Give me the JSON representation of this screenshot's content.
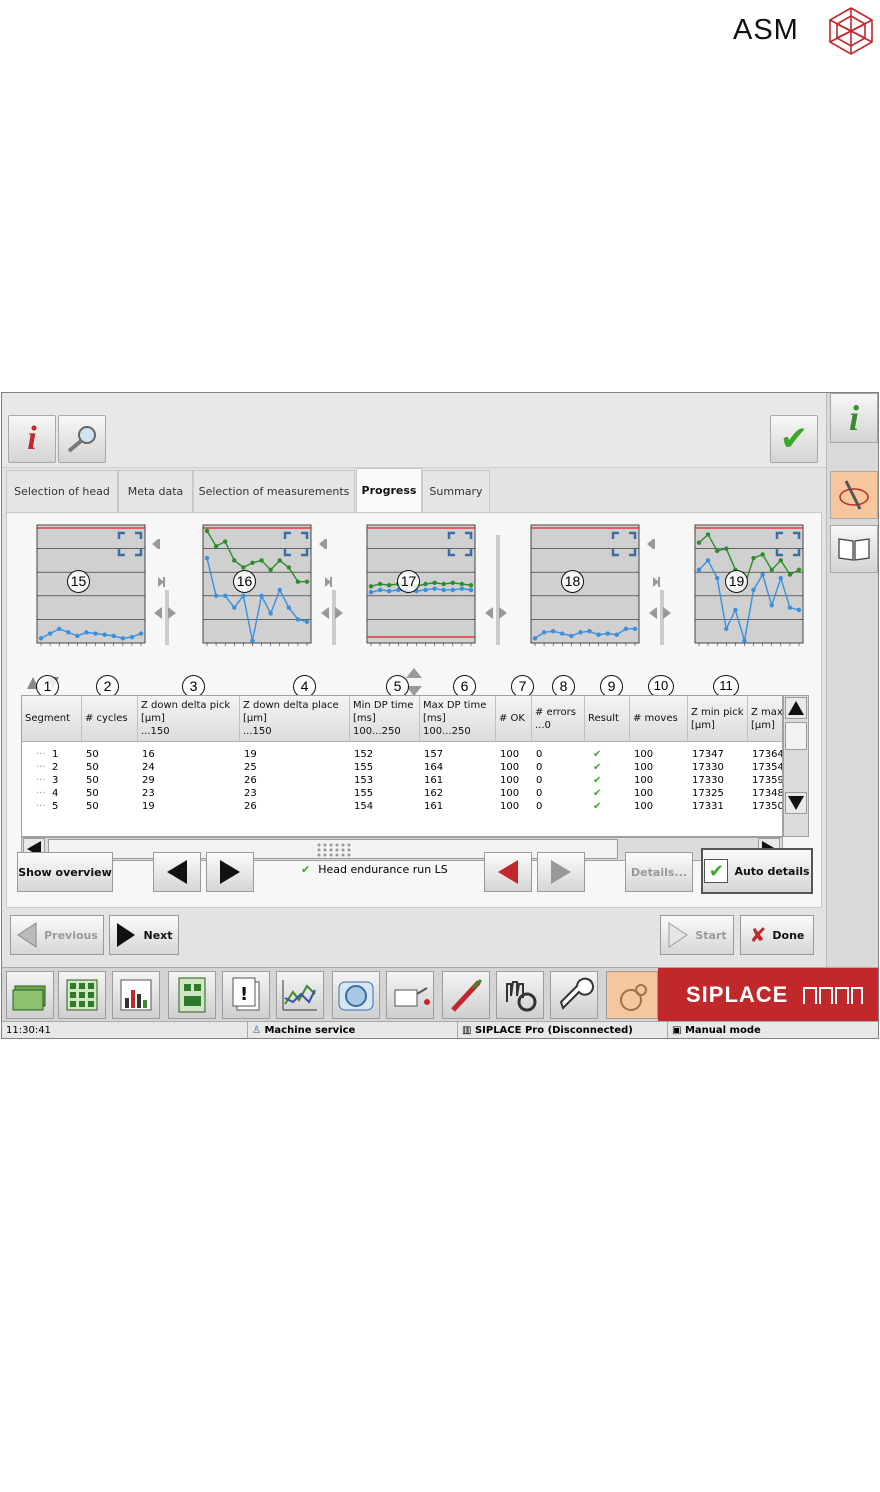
{
  "logo": {
    "text": "ASM"
  },
  "tabs": [
    "Selection of head",
    "Meta data",
    "Selection of measurements",
    "Progress",
    "Summary"
  ],
  "active_tab": "Progress",
  "charts": [
    {
      "callout": "15",
      "series": [
        [
          0.04,
          0.08,
          0.12,
          0.09,
          0.06,
          0.09,
          0.08,
          0.07,
          0.06,
          0.04,
          0.05,
          0.08
        ]
      ]
    },
    {
      "callout": "16",
      "series": [
        [
          0.95,
          0.82,
          0.86,
          0.7,
          0.64,
          0.68,
          0.7,
          0.62,
          0.7,
          0.64,
          0.52,
          0.52
        ],
        [
          0.72,
          0.4,
          0.4,
          0.3,
          0.4,
          0.02,
          0.4,
          0.25,
          0.45,
          0.3,
          0.2,
          0.18
        ]
      ]
    },
    {
      "callout": "17",
      "series": [
        [
          0.48,
          0.5,
          0.49,
          0.5,
          0.49,
          0.48,
          0.5,
          0.51,
          0.5,
          0.51,
          0.5,
          0.49
        ],
        [
          0.43,
          0.45,
          0.44,
          0.45,
          0.44,
          0.44,
          0.45,
          0.46,
          0.45,
          0.45,
          0.46,
          0.45
        ]
      ]
    },
    {
      "callout": "18",
      "series": [
        [
          0.04,
          0.09,
          0.1,
          0.08,
          0.06,
          0.09,
          0.1,
          0.07,
          0.08,
          0.07,
          0.12,
          0.12
        ]
      ]
    },
    {
      "callout": "19",
      "series": [
        [
          0.85,
          0.92,
          0.78,
          0.8,
          0.62,
          0.48,
          0.72,
          0.75,
          0.62,
          0.7,
          0.58,
          0.62
        ],
        [
          0.62,
          0.7,
          0.55,
          0.12,
          0.28,
          0.02,
          0.45,
          0.58,
          0.32,
          0.55,
          0.3,
          0.28
        ]
      ]
    }
  ],
  "table": {
    "callouts": [
      "1",
      "2",
      "3",
      "4",
      "5",
      "6",
      "7",
      "8",
      "9",
      "10",
      "11"
    ],
    "headers": [
      "Segment",
      "# cycles",
      "Z down delta pick\n[µm]\n...150",
      "Z down delta place\n[µm]\n...150",
      "Min DP time\n[ms]\n100...250",
      "Max DP time\n[ms]\n100...250",
      "# OK",
      "# errors\n...0",
      "Result",
      "# moves",
      "Z min pick\n[µm]",
      "Z max\n[µm]"
    ],
    "rows": [
      [
        "1",
        "50",
        "16",
        "19",
        "152",
        "157",
        "100",
        "0",
        "✔",
        "100",
        "17347",
        "17364"
      ],
      [
        "2",
        "50",
        "24",
        "25",
        "155",
        "164",
        "100",
        "0",
        "✔",
        "100",
        "17330",
        "17354"
      ],
      [
        "3",
        "50",
        "29",
        "26",
        "153",
        "161",
        "100",
        "0",
        "✔",
        "100",
        "17330",
        "17359"
      ],
      [
        "4",
        "50",
        "23",
        "23",
        "155",
        "162",
        "100",
        "0",
        "✔",
        "100",
        "17325",
        "17348"
      ],
      [
        "5",
        "50",
        "19",
        "26",
        "154",
        "161",
        "100",
        "0",
        "✔",
        "100",
        "17331",
        "17350"
      ]
    ]
  },
  "buttons": {
    "show_overview": "Show overview",
    "status_text": "Head endurance run LS",
    "details": "Details...",
    "auto_details": "Auto details",
    "previous": "Previous",
    "next": "Next",
    "start": "Start",
    "done": "Done"
  },
  "brand": "SIPLACE",
  "statusbar": {
    "time": "11:30:41",
    "user": "Machine service",
    "connection": "SIPLACE Pro (Disconnected)",
    "mode": "Manual mode"
  },
  "colors": {
    "brand_red": "#c0282c",
    "series_blue": "#3a8fe0",
    "series_green": "#2e8b2e",
    "limit_red": "#e02020"
  }
}
